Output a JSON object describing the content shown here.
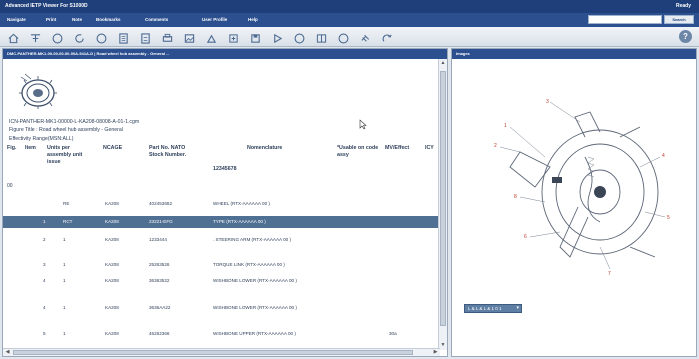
{
  "window": {
    "title": "Advanced IETP Viewer For S1000D",
    "status": "Ready"
  },
  "menu": [
    "Navigate",
    "Print",
    "Note",
    "Bookmarks",
    "Comments",
    "User Profile",
    "Help"
  ],
  "search": {
    "value": "",
    "button_label": "Search"
  },
  "toolbar": {
    "buttons": [
      "home-icon",
      "tree-icon",
      "back-icon",
      "refresh-icon",
      "forward-icon",
      "document-icon",
      "list-icon",
      "print-icon",
      "image-icon",
      "upload-icon",
      "zoom-in-icon",
      "save-icon",
      "play-icon",
      "record-icon",
      "book-icon",
      "circle-icon",
      "link-icon",
      "redo-icon"
    ]
  },
  "left_pane": {
    "header": "DMC-PANTHER-MK1-00-00-00-00-00A-941A-D | Road wheel hub assembly - General ...",
    "icn": "ICN-PANTHER-MK1-00000-L-KA208-08008-A-01-1.cgm",
    "figure_title": "Figure Title : Road wheel hub assembly - General",
    "effectivity": "Effectivity Range(MSN:ALL)",
    "columns": {
      "fig": "Fig.",
      "item": "Item",
      "units": "Units per assembly unit issue",
      "ncage": "NCAGE",
      "part": "Part No. NATO Stock Number.",
      "nomenclature": "Nomenclature",
      "nomenclature_sub": "12345678",
      "usable": "*Usable on code assy",
      "mv_effect": "MV/Effect",
      "icy": "ICY"
    },
    "figure_number": "00",
    "rows": [
      {
        "fig": "",
        "item": "",
        "units": "RE",
        "ncage": "KA208",
        "part": "402453682",
        "nomenclature": "WHEEL (RTX-AAAAAA 00 )",
        "mv": ""
      },
      {
        "fig": "",
        "item": "1",
        "units": "RCT",
        "ncage": "KA208",
        "part": "23221-EFG",
        "nomenclature": "TYPE (RTX-AAAAAA 00 )",
        "mv": ""
      },
      {
        "fig": "",
        "item": "2",
        "units": "1",
        "ncage": "KA208",
        "part": "1233444",
        "nomenclature": ". STEERING ARM (RTX-AAAAAA 00 )",
        "mv": ""
      },
      {
        "fig": "",
        "item": "3",
        "units": "1",
        "ncage": "KA208",
        "part": "25263526",
        "nomenclature": "TORQUE LINK (RTX-AAAAAA 00 )",
        "mv": ""
      },
      {
        "fig": "",
        "item": "4",
        "units": "1",
        "ncage": "KA208",
        "part": "36363522",
        "nomenclature": "WISHBONE LOWER (RTX-AAAAAA 00 )",
        "mv": ""
      },
      {
        "fig": "",
        "item": "4",
        "units": "1",
        "ncage": "KA208",
        "part": "3636AA22",
        "nomenclature": "WISHBONE LOWER (RTX-AAAAAA 00 )",
        "mv": ""
      },
      {
        "fig": "",
        "item": "5",
        "units": "1",
        "ncage": "KA208",
        "part": "46262366",
        "nomenclature": "WISHBONE UPPER (RTX-AAAAAA 00 )",
        "mv": "30a"
      }
    ],
    "selected_row_index": 1
  },
  "right_pane": {
    "header": "Images",
    "zoom_value": "L & L & L & 1 0 1"
  },
  "colors": {
    "title_bar": "#1e3f7a",
    "menu_bar": "#2b4f8f",
    "selected_row": "#4f6f93",
    "text": "#2d3f5a"
  }
}
